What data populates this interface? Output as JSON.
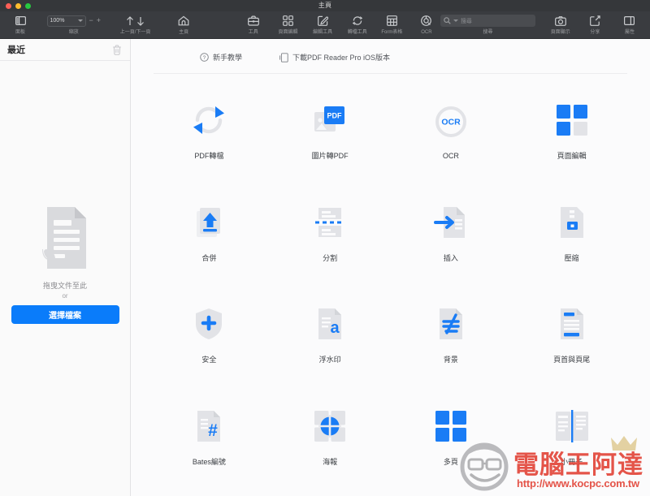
{
  "window": {
    "title": "主頁",
    "traffic_lights": [
      "close",
      "minimize",
      "maximize"
    ]
  },
  "toolbar": {
    "items": [
      {
        "name": "panel",
        "icon": "sidebar-icon",
        "label": "面板"
      },
      {
        "name": "zoom",
        "icon": "zoom-control",
        "label": "縮放",
        "value": "100%",
        "minus": "−",
        "plus": "+"
      },
      {
        "name": "page-nav",
        "icon": "arrow-up-down-icon",
        "label": "上一頁/下一頁"
      },
      {
        "name": "home",
        "icon": "home-icon",
        "label": "主頁"
      },
      {
        "name": "tools",
        "icon": "briefcase-icon",
        "label": "工具"
      },
      {
        "name": "page-edit",
        "icon": "grid-four-icon",
        "label": "頁面編輯"
      },
      {
        "name": "edit-tools",
        "icon": "pencil-square-icon",
        "label": "編輯工具"
      },
      {
        "name": "convert-tools",
        "icon": "refresh-icon",
        "label": "轉檔工具"
      },
      {
        "name": "form",
        "icon": "table-icon",
        "label": "Form表格"
      },
      {
        "name": "ocr",
        "icon": "ocr-target-icon",
        "label": "OCR"
      },
      {
        "name": "search",
        "icon": "search-icon",
        "label": "搜尋",
        "placeholder": "搜尋"
      },
      {
        "name": "page-display",
        "icon": "camera-icon",
        "label": "頁面顯示"
      },
      {
        "name": "share",
        "icon": "share-icon",
        "label": "分享"
      },
      {
        "name": "properties",
        "icon": "properties-icon",
        "label": "屬性"
      }
    ]
  },
  "sidebar": {
    "title": "最近",
    "clear_icon": "trash-icon",
    "drop_icon": "document-drop-icon",
    "drop_text": "拖曳文件至此",
    "or_text": "or",
    "choose_button": "選擇檔案"
  },
  "main": {
    "quick_links": [
      {
        "name": "tutorial",
        "icon": "question-circle-icon",
        "label": "新手教學"
      },
      {
        "name": "download-ios",
        "icon": "phone-icon",
        "label": "下載PDF Reader Pro iOS版本"
      }
    ],
    "tools": [
      {
        "name": "pdf-convert",
        "icon": "convert-arrows-icon",
        "label": "PDF轉檔"
      },
      {
        "name": "image-to-pdf",
        "icon": "image-pdf-icon",
        "label": "圖片轉PDF"
      },
      {
        "name": "ocr",
        "icon": "ocr-circle-icon",
        "label": "OCR"
      },
      {
        "name": "page-edit",
        "icon": "four-squares-icon",
        "label": "頁面編輯"
      },
      {
        "name": "merge",
        "icon": "merge-arrow-up-icon",
        "label": "合併"
      },
      {
        "name": "split",
        "icon": "split-dashed-icon",
        "label": "分割"
      },
      {
        "name": "insert",
        "icon": "insert-arrow-icon",
        "label": "插入"
      },
      {
        "name": "compress",
        "icon": "compress-icon",
        "label": "壓縮"
      },
      {
        "name": "security",
        "icon": "shield-plus-icon",
        "label": "安全"
      },
      {
        "name": "watermark",
        "icon": "watermark-a-icon",
        "label": "浮水印"
      },
      {
        "name": "background",
        "icon": "background-icon",
        "label": "背景"
      },
      {
        "name": "header-footer",
        "icon": "header-footer-icon",
        "label": "頁首與頁尾"
      },
      {
        "name": "bates",
        "icon": "hash-doc-icon",
        "label": "Bates編號"
      },
      {
        "name": "poster",
        "icon": "poster-circle-icon",
        "label": "海報"
      },
      {
        "name": "multipage",
        "icon": "four-blue-squares-icon",
        "label": "多頁"
      },
      {
        "name": "booklet",
        "icon": "booklet-icon",
        "label": "小冊子"
      }
    ]
  },
  "watermark": {
    "brand": "電腦王阿達",
    "url": "http://www.kocpc.com.tw"
  },
  "colors": {
    "accent_blue": "#0a7cfa",
    "icon_grey": "#dcdee2",
    "toolbar_bg": "#3a3c40",
    "titlebar_bg": "#35373a",
    "watermark_red": "#e3483c"
  }
}
